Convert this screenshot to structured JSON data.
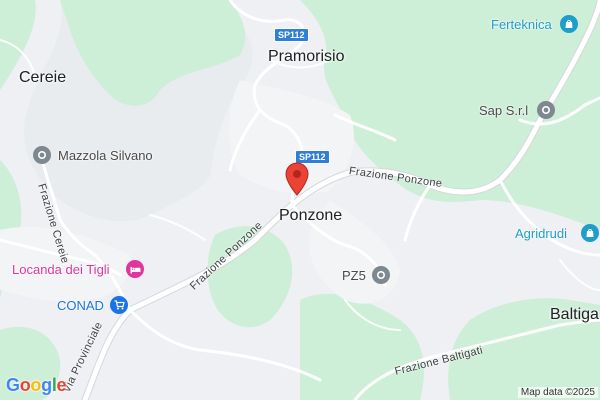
{
  "map": {
    "towns": [
      "Pramorisio",
      "Ponzone",
      "Cereie",
      "Baltiga"
    ],
    "road_shields": [
      "SP112",
      "SP112"
    ],
    "streets": [
      "Frazione Ponzone",
      "Frazione Ponzone",
      "Frazione Cereie",
      "Via Provinciale",
      "Frazione Baltigati"
    ],
    "pois": {
      "ferteknica": "Ferteknica",
      "sap": "Sap S.r.l",
      "mazzola": "Mazzola Silvano",
      "agridrudi": "Agridrudi",
      "locanda": "Locanda dei Tigli",
      "conad": "CONAD",
      "pz5": "PZ5"
    },
    "credit": "Map data ©2025",
    "logo_letters": [
      "G",
      "o",
      "o",
      "g",
      "l",
      "e"
    ],
    "colors": {
      "land": "#eef0f3",
      "forest": "#c8ebd4",
      "road": "#ffffff",
      "main_road": "#fefefe",
      "shield": "#2f7fd6",
      "pin": "#ea4335",
      "hotel": "#e0359e",
      "shop": "#1a73e8",
      "store": "#1e9ecb"
    },
    "icons": {
      "pin": "location-pin-icon",
      "shop_bag": "shopping-bag-icon",
      "bed": "hotel-bed-icon",
      "cart": "shopping-cart-icon",
      "place": "place-icon"
    }
  }
}
